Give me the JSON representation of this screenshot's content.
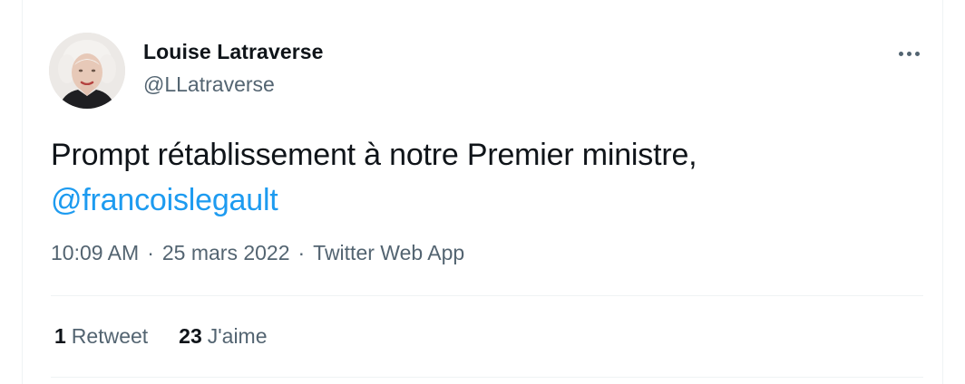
{
  "author": {
    "name": "Louise Latraverse",
    "handle": "@LLatraverse",
    "avatar_icon": "user-avatar-photo"
  },
  "tweet": {
    "text": "Prompt rétablissement à notre Premier ministre,",
    "mention": "@francoislegault"
  },
  "meta": {
    "time": "10:09 AM",
    "separator": "·",
    "date": "25 mars 2022",
    "source": "Twitter Web App"
  },
  "stats": {
    "retweets_count": "1",
    "retweets_label": "Retweet",
    "likes_count": "23",
    "likes_label": "J'aime"
  },
  "icons": {
    "more": "more-horizontal-icon"
  },
  "colors": {
    "text": "#0f1419",
    "secondary": "#536471",
    "accent": "#1d9bf0",
    "divider": "#eff3f4"
  }
}
